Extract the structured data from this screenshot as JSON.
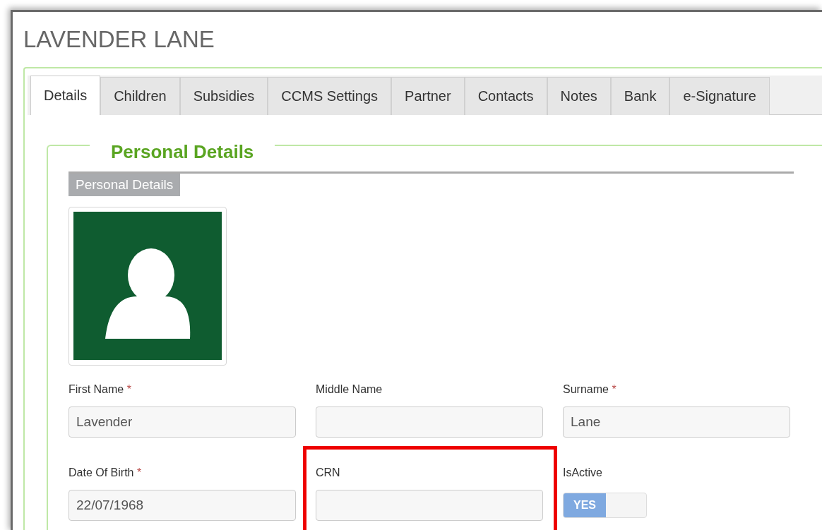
{
  "page": {
    "title": "LAVENDER LANE"
  },
  "tabs": [
    {
      "label": "Details",
      "selected": true
    },
    {
      "label": "Children",
      "selected": false
    },
    {
      "label": "Subsidies",
      "selected": false
    },
    {
      "label": "CCMS Settings",
      "selected": false
    },
    {
      "label": "Partner",
      "selected": false
    },
    {
      "label": "Contacts",
      "selected": false
    },
    {
      "label": "Notes",
      "selected": false
    },
    {
      "label": "Bank",
      "selected": false
    },
    {
      "label": "e-Signature",
      "selected": false
    }
  ],
  "required_mark": "*",
  "section": {
    "legend": "Personal Details",
    "subheading": "Personal Details"
  },
  "fields": [
    {
      "kind": "text",
      "label": "First Name",
      "required": true,
      "value": "Lavender",
      "highlighted": false
    },
    {
      "kind": "text",
      "label": "Middle Name",
      "required": false,
      "highlighted": false
    },
    {
      "kind": "text",
      "label": "Surname",
      "required": true,
      "value": "Lane",
      "highlighted": false
    },
    {
      "kind": "text",
      "label": "Date Of Birth",
      "required": true,
      "value": "22/07/1968",
      "highlighted": false
    },
    {
      "kind": "text",
      "label": "CRN",
      "required": false,
      "highlighted": true
    },
    {
      "kind": "toggle",
      "label": "IsActive",
      "required": false,
      "on": true,
      "on_label": "YES",
      "highlighted": false
    }
  ]
}
